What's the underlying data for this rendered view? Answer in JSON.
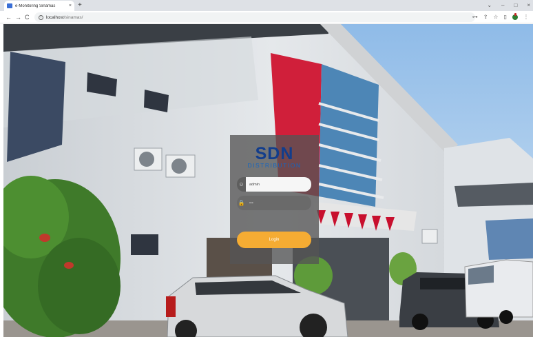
{
  "browser": {
    "tab_title": "e-Monitoring Sinamas",
    "tab_close": "×",
    "new_tab": "+",
    "nav_back": "←",
    "nav_forward": "→",
    "nav_reload": "C",
    "url_host": "localhost",
    "url_path": "/sinamas/",
    "window_controls": {
      "chevron": "⌄",
      "minimize": "–",
      "maximize": "□",
      "close": "×"
    },
    "tool_icons": {
      "key": "⊶",
      "share": "⇪",
      "star": "☆",
      "sidebar": "▯",
      "menu": "⋮"
    }
  },
  "login": {
    "brand_name": "SDN",
    "brand_sub": "DISTRIBUTION",
    "username_value": "admin",
    "password_value": "•••",
    "login_label": "Login",
    "user_icon": "☺",
    "lock_icon": "🔒"
  },
  "colors": {
    "brand_blue": "#123d8c",
    "login_button": "#f5ac33",
    "card_bg": "rgba(85,85,85,0.78)"
  }
}
